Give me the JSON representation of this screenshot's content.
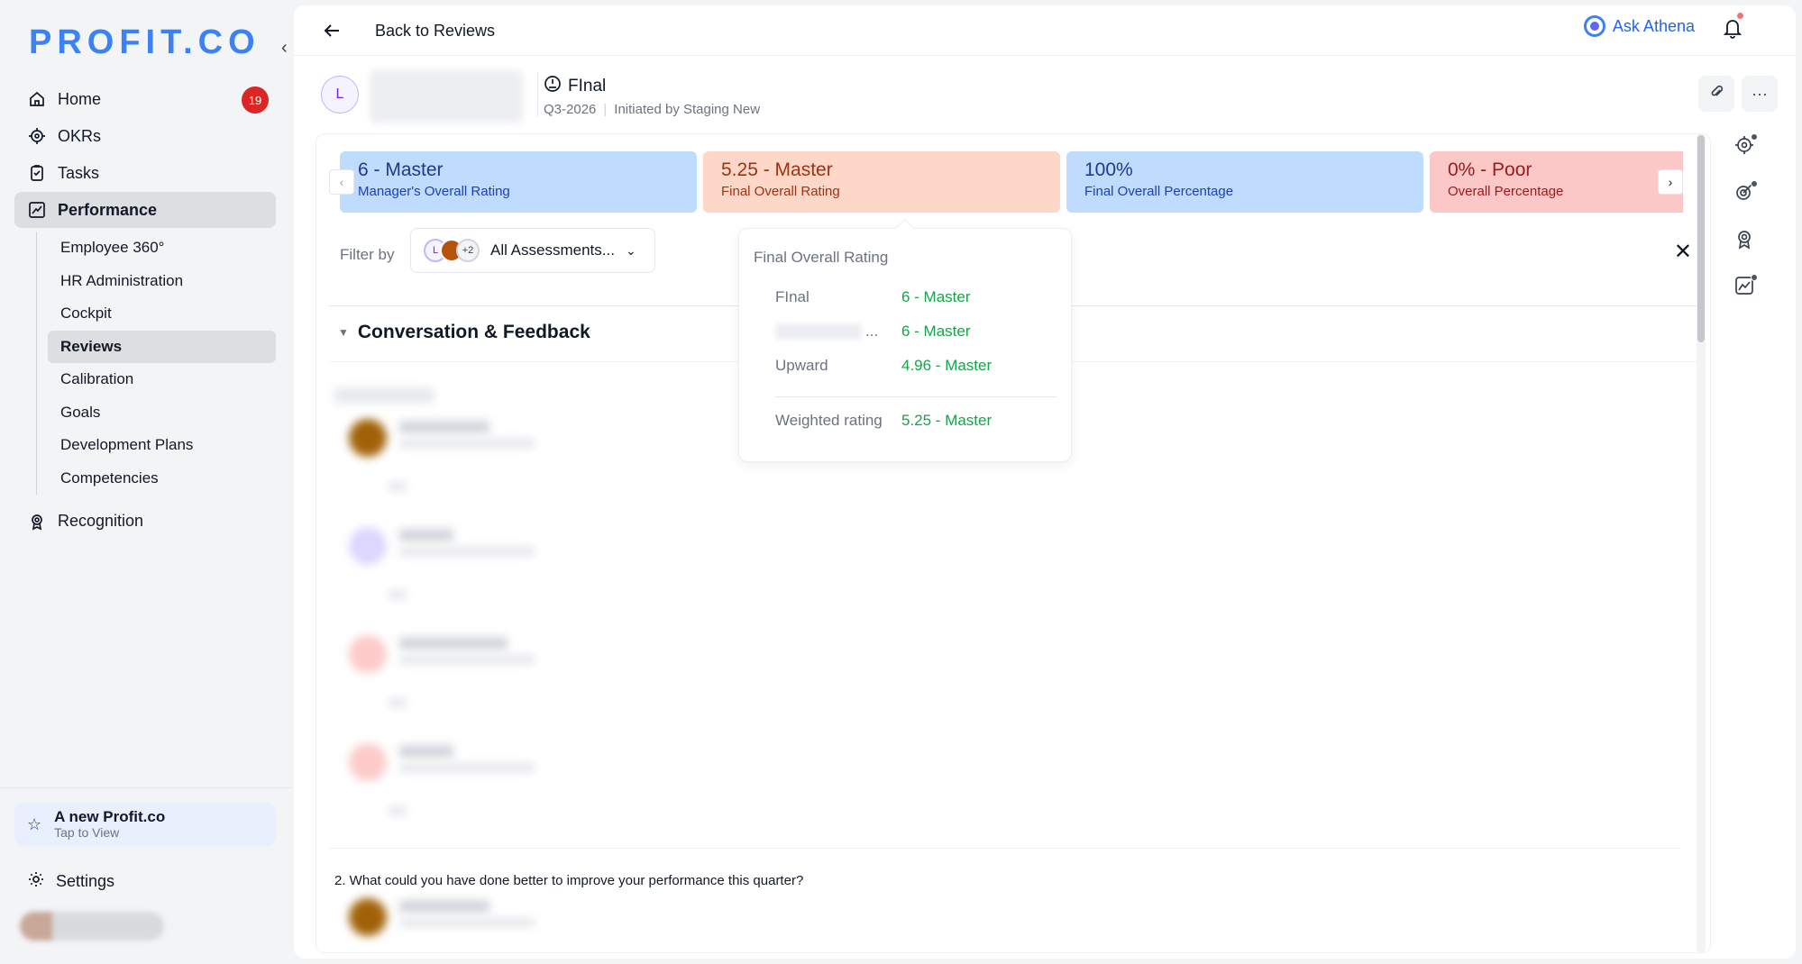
{
  "brand": {
    "logo_text": "PROFIT.CO"
  },
  "sidebar": {
    "home": {
      "label": "Home",
      "badge": "19"
    },
    "okrs": {
      "label": "OKRs"
    },
    "tasks": {
      "label": "Tasks"
    },
    "performance": {
      "label": "Performance"
    },
    "sub_items": [
      "Employee 360°",
      "HR Administration",
      "Cockpit",
      "Reviews",
      "Calibration",
      "Goals",
      "Development Plans",
      "Competencies"
    ],
    "recognition": {
      "label": "Recognition"
    },
    "promo": {
      "title": "A new Profit.co",
      "subtitle": "Tap to View"
    },
    "settings": {
      "label": "Settings"
    }
  },
  "topbar": {
    "back_label": "Back to Reviews",
    "ask_athena": "Ask Athena"
  },
  "review": {
    "avatar_initial": "L",
    "title": "FInal",
    "period": "Q3-2026",
    "initiated_by": "Initiated by Staging New"
  },
  "cards": [
    {
      "value": "6 - Master",
      "label": "Manager's Overall Rating",
      "tone": "blue"
    },
    {
      "value": "5.25 - Master",
      "label": "Final Overall Rating",
      "tone": "peach"
    },
    {
      "value": "100%",
      "label": "Final Overall Percentage",
      "tone": "blue"
    },
    {
      "value": "0% - Poor",
      "label": "Overall Percentage",
      "tone": "red"
    }
  ],
  "filter": {
    "label": "Filter by",
    "avatar_initial": "L",
    "extra_count": "+2",
    "selected": "All Assessments..."
  },
  "section": {
    "title": "Conversation & Feedback"
  },
  "question": "2. What could you have done better to improve your performance this quarter?",
  "tooltip": {
    "title": "Final Overall Rating",
    "rows": [
      {
        "key": "FInal",
        "value": "6 - Master"
      },
      {
        "key": "...",
        "value": "6 - Master"
      },
      {
        "key": "Upward",
        "value": "4.96 - Master"
      }
    ],
    "weighted": {
      "key": "Weighted rating",
      "value": "5.25 - Master"
    }
  },
  "colors": {
    "accent": "#3b82f6",
    "success": "#16a34a",
    "danger": "#dc2626"
  }
}
